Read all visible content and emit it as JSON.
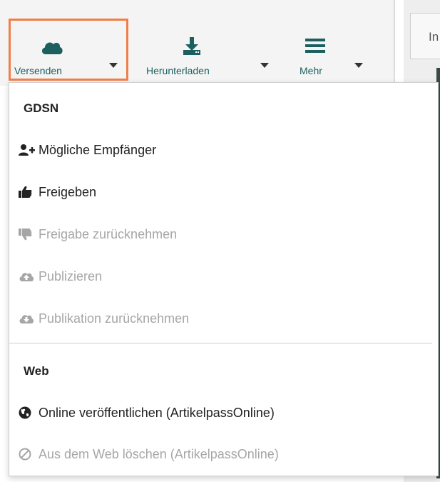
{
  "toolbar": {
    "send_label": "Versenden",
    "download_label": "Herunterladen",
    "more_label": "Mehr"
  },
  "right_tab_label": "In",
  "menu": {
    "gdsn_title": "GDSN",
    "gdsn_items": [
      {
        "label": "Mögliche Empfänger",
        "icon": "add-user-icon",
        "enabled": true
      },
      {
        "label": "Freigeben",
        "icon": "thumbs-up-icon",
        "enabled": true
      },
      {
        "label": "Freigabe zurücknehmen",
        "icon": "thumbs-down-icon",
        "enabled": false
      },
      {
        "label": "Publizieren",
        "icon": "cloud-upload-icon",
        "enabled": false
      },
      {
        "label": "Publikation zurücknehmen",
        "icon": "cloud-download-icon",
        "enabled": false
      }
    ],
    "web_title": "Web",
    "web_items": [
      {
        "label": "Online veröffentlichen (ArtikelpassOnline)",
        "icon": "globe-icon",
        "enabled": true
      },
      {
        "label": "Aus dem Web löschen (ArtikelpassOnline)",
        "icon": "ban-icon",
        "enabled": false
      }
    ]
  },
  "colors": {
    "accent": "#1c5f5f",
    "highlight": "#f07f47",
    "disabled": "#a6a6a6"
  }
}
